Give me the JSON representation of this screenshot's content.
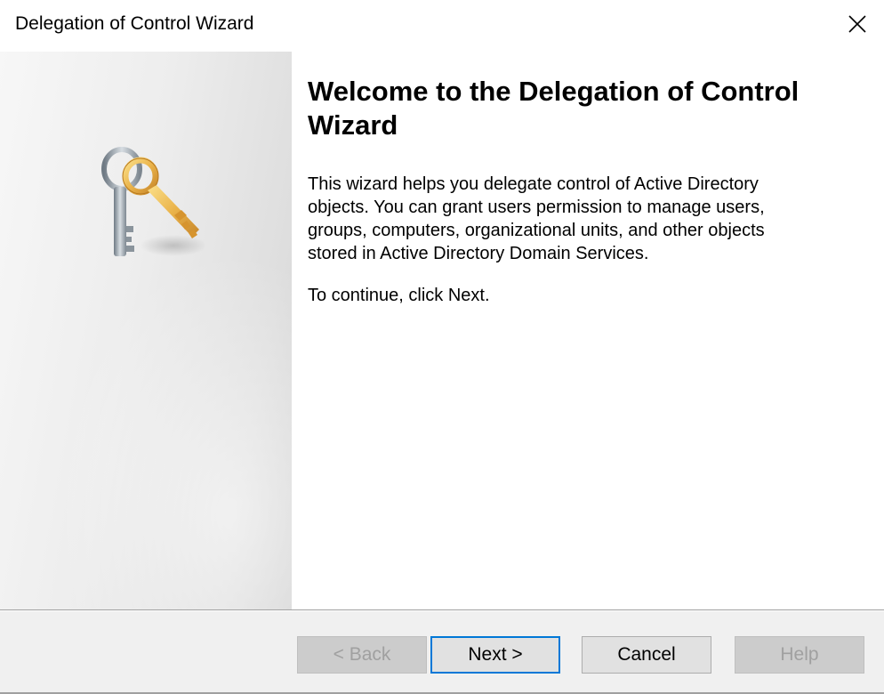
{
  "window": {
    "title": "Delegation of Control Wizard"
  },
  "page": {
    "heading": "Welcome to the Delegation of Control Wizard",
    "description": "This wizard helps you delegate control of Active Directory\nobjects. You can grant users permission to manage users,\ngroups, computers, organizational units, and other objects\nstored in Active Directory Domain Services.",
    "continue_text": "To continue, click Next."
  },
  "icons": {
    "close": "close-icon",
    "banner": "keys-icon"
  },
  "buttons": {
    "back": {
      "label": "< Back",
      "enabled": false
    },
    "next": {
      "label": "Next >",
      "enabled": true,
      "default": true
    },
    "cancel": {
      "label": "Cancel",
      "enabled": true
    },
    "help": {
      "label": "Help",
      "enabled": false
    }
  },
  "colors": {
    "default_button_border": "#0078d7",
    "key_gold": "#e8a630",
    "key_silver": "#9aa4ad"
  }
}
